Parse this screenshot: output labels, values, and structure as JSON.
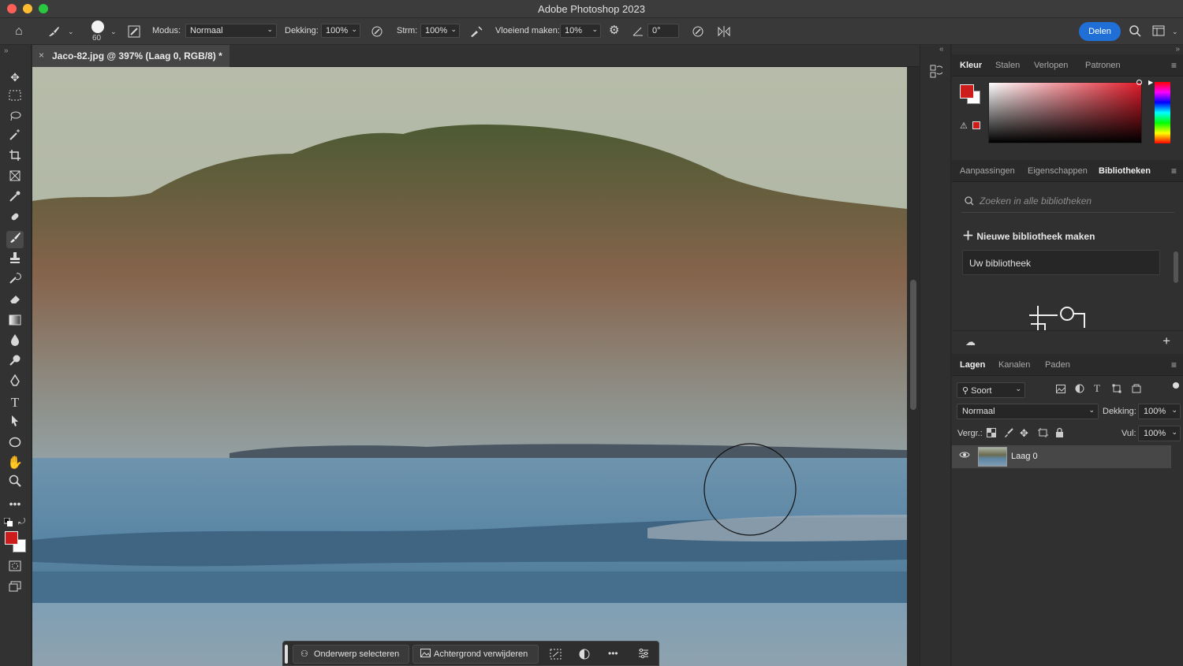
{
  "window": {
    "title": "Adobe Photoshop 2023"
  },
  "colors": {
    "accent": "#1f6fd6",
    "foreground": "#cc1c1c",
    "background": "#ffffff"
  },
  "options": {
    "brush_size": "60",
    "mode_label": "Modus:",
    "mode_value": "Normaal",
    "opacity_label": "Dekking:",
    "opacity_value": "100%",
    "flow_label": "Strm:",
    "flow_value": "100%",
    "smoothing_label": "Vloeiend maken:",
    "smoothing_value": "10%",
    "angle_value": "0°",
    "share_label": "Delen"
  },
  "document": {
    "tab_label": "Jaco-82.jpg @ 397% (Laag 0, RGB/8) *"
  },
  "context_bar": {
    "select_subject": "Onderwerp selecteren",
    "remove_background": "Achtergrond verwijderen"
  },
  "panels": {
    "color_tabs": [
      "Kleur",
      "Stalen",
      "Verlopen",
      "Patronen"
    ],
    "mid_tabs": [
      "Aanpassingen",
      "Eigenschappen",
      "Bibliotheken"
    ],
    "libraries": {
      "search_placeholder": "Zoeken in alle bibliotheken",
      "new_library": "Nieuwe bibliotheek maken",
      "your_library": "Uw bibliotheek"
    },
    "layer_tabs": [
      "Lagen",
      "Kanalen",
      "Paden"
    ],
    "layers": {
      "filter_kind": "Soort",
      "blend_mode": "Normaal",
      "opacity_label": "Dekking:",
      "opacity_value": "100%",
      "lock_label": "Vergr.:",
      "fill_label": "Vul:",
      "fill_value": "100%",
      "items": [
        {
          "name": "Laag 0"
        }
      ]
    }
  },
  "icons": [
    "home-icon",
    "brush-icon",
    "gear-icon",
    "search-icon",
    "eye-icon",
    "plus-icon",
    "cloud-icon"
  ]
}
